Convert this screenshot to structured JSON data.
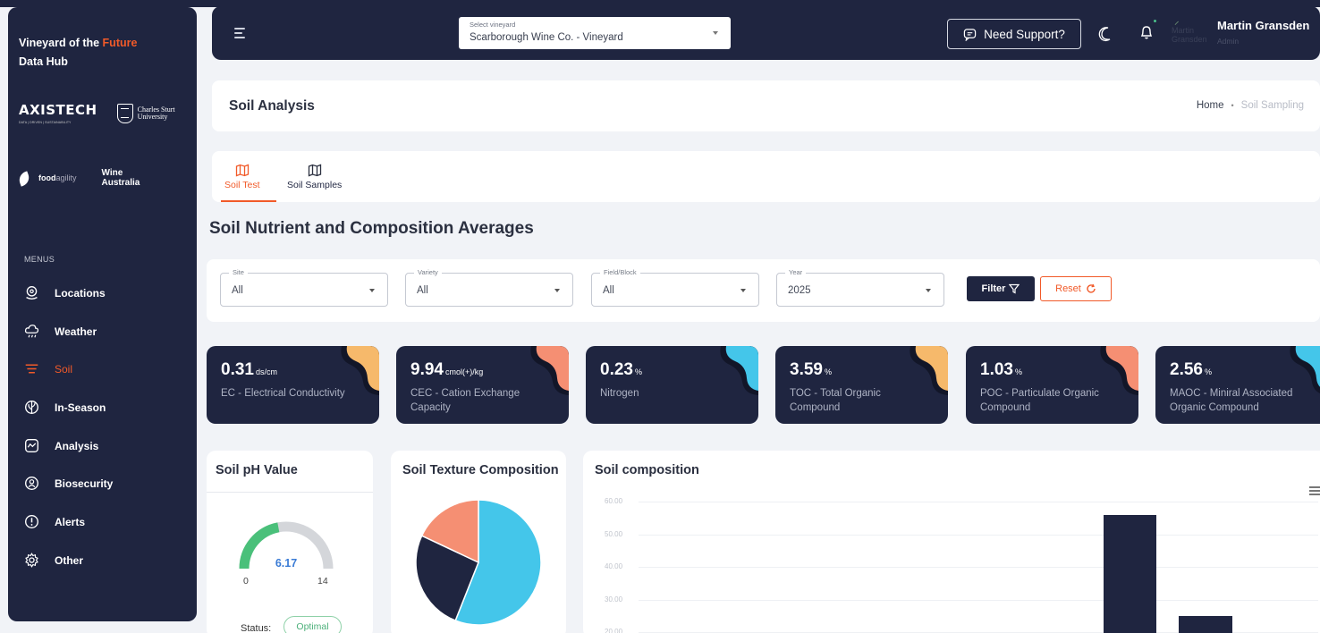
{
  "sidebar": {
    "brand_line1": "Vineyard of the ",
    "brand_accent": "Future",
    "brand_line2": "Data Hub",
    "logo_axistech": "AXISTECH",
    "logo_axistech_tag": "DATA | DRIVEN | SUSTAINABILITY",
    "logo_csu": "Charles Sturt University",
    "logo_foodagility_bold": "food",
    "logo_foodagility_light": "agility",
    "logo_wine_line1": "Wine",
    "logo_wine_line2": "Australia",
    "menus_label": "MENUS",
    "items": [
      {
        "label": "Locations",
        "icon": "location-pin-icon"
      },
      {
        "label": "Weather",
        "icon": "cloud-rain-icon"
      },
      {
        "label": "Soil",
        "icon": "layers-icon",
        "active": true
      },
      {
        "label": "In-Season",
        "icon": "leaf-icon"
      },
      {
        "label": "Analysis",
        "icon": "chart-line-icon"
      },
      {
        "label": "Biosecurity",
        "icon": "shield-icon"
      },
      {
        "label": "Alerts",
        "icon": "alert-circle-icon"
      },
      {
        "label": "Other",
        "icon": "gear-icon"
      }
    ]
  },
  "topbar": {
    "vineyard_label": "Select vineyard",
    "vineyard_value": "Scarborough Wine Co. - Vineyard",
    "support_label": "Need Support?",
    "avatar_text": "Martin Gransden",
    "user_name": "Martin Gransden",
    "user_role": "Admin"
  },
  "page": {
    "title": "Soil Analysis",
    "breadcrumb_home": "Home",
    "breadcrumb_current": "Soil Sampling"
  },
  "tabs": [
    {
      "label": "Soil Test",
      "active": true
    },
    {
      "label": "Soil Samples",
      "active": false
    }
  ],
  "section_title": "Soil Nutrient and Composition Averages",
  "filters": {
    "site": {
      "label": "Site",
      "value": "All"
    },
    "variety": {
      "label": "Variety",
      "value": "All"
    },
    "field": {
      "label": "Field/Block",
      "value": "All"
    },
    "year": {
      "label": "Year",
      "value": "2025"
    },
    "filter_label": "Filter",
    "reset_label": "Reset"
  },
  "cards": [
    {
      "value": "0.31",
      "unit": "ds/cm",
      "label": "EC - Electrical Conductivity",
      "accent": "#f6b96b"
    },
    {
      "value": "9.94",
      "unit": "cmol(+)/kg",
      "label": "CEC - Cation Exchange Capacity",
      "accent": "#f58f73"
    },
    {
      "value": "0.23",
      "unit": "%",
      "label": "Nitrogen",
      "accent": "#44c6ea"
    },
    {
      "value": "3.59",
      "unit": "%",
      "label": "TOC - Total Organic Compound",
      "accent": "#f6b96b"
    },
    {
      "value": "1.03",
      "unit": "%",
      "label": "POC - Particulate Organic Compound",
      "accent": "#f58f73"
    },
    {
      "value": "2.56",
      "unit": "%",
      "label": "MAOC - Miniral Associated Organic Compound",
      "accent": "#44c6ea"
    }
  ],
  "ph_panel": {
    "title": "Soil pH Value",
    "value": "6.17",
    "min": "0",
    "max": "14",
    "status_label": "Status:",
    "status_value": "Optimal",
    "colors": {
      "fill": "#4ac07a",
      "track": "#d4d6da"
    }
  },
  "texture_panel": {
    "title": "Soil Texture Composition"
  },
  "composition_panel": {
    "title": "Soil composition",
    "yticks": [
      "60.00",
      "50.00",
      "40.00",
      "30.00",
      "20.00"
    ]
  },
  "chart_data": [
    {
      "type": "pie",
      "title": "Soil Texture Composition",
      "slices": [
        {
          "value": 56,
          "color": "#44c6ea"
        },
        {
          "value": 26,
          "color": "#1f2540"
        },
        {
          "value": 18,
          "color": "#f58f73"
        }
      ]
    },
    {
      "type": "bar",
      "title": "Soil composition",
      "ylim": [
        20,
        60
      ],
      "grid": true,
      "values": [
        56,
        25
      ]
    }
  ]
}
